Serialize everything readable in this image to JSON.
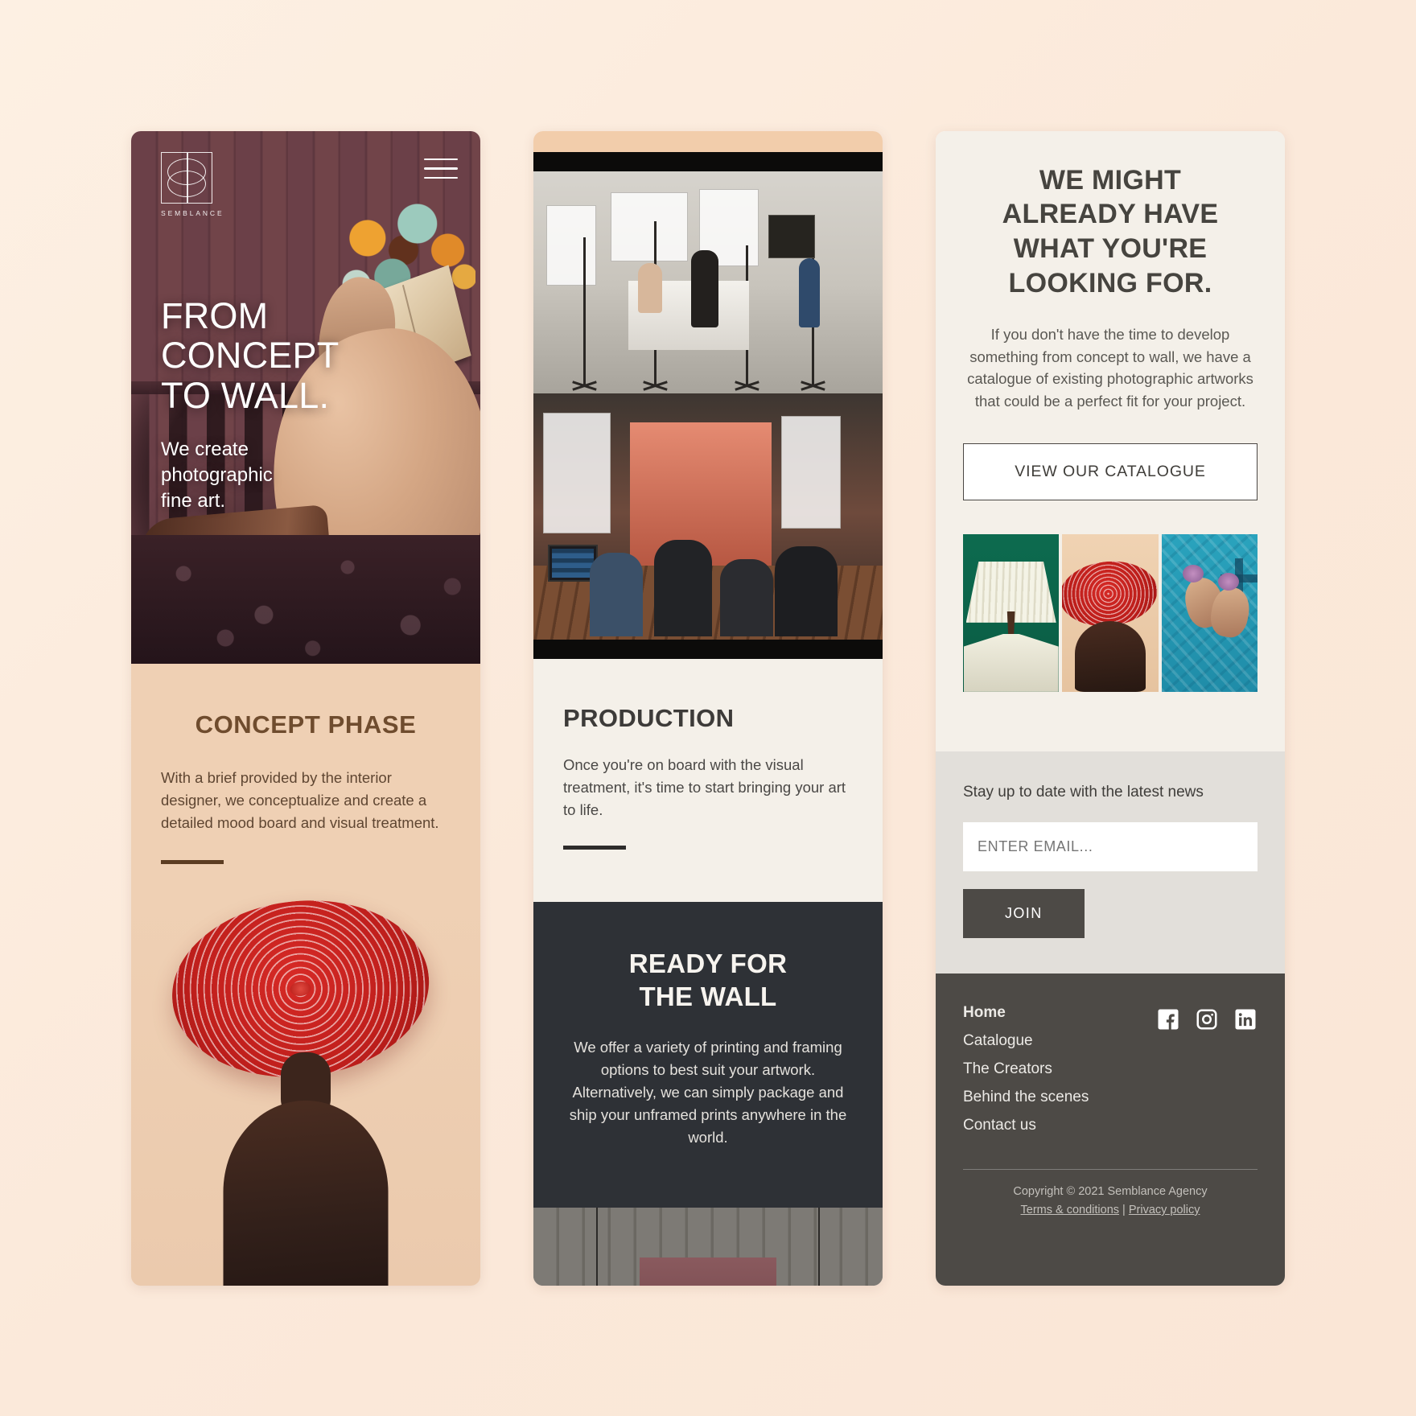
{
  "brand": {
    "name": "SEMBLANCE",
    "logo_icon": "semblance-logo-icon",
    "menu_icon": "hamburger-menu-icon"
  },
  "panel1": {
    "hero": {
      "title_lines": [
        "FROM",
        "CONCEPT",
        "TO WALL."
      ],
      "subtitle_lines": [
        "We create",
        "photographic",
        "fine art."
      ]
    },
    "concept": {
      "heading": "CONCEPT PHASE",
      "body": "With a brief provided by the interior designer,  we conceptualize and create a detailed mood board and visual treatment."
    }
  },
  "panel2": {
    "production": {
      "heading": "PRODUCTION",
      "body": "Once you're on board with the visual treatment, it's time to start bringing your art to life."
    },
    "ready": {
      "heading_lines": [
        "READY FOR",
        "THE WALL"
      ],
      "body": "We offer a variety of printing and framing options to best suit your artwork. Alternatively, we can simply package and ship your unframed prints anywhere in the world."
    }
  },
  "panel3": {
    "catalogue": {
      "heading_lines": [
        "WE MIGHT",
        "ALREADY HAVE",
        "WHAT YOU'RE",
        "LOOKING FOR."
      ],
      "body": "If you don't have the time to develop something from concept to wall, we have a catalogue of existing photographic artworks that could be a perfect fit for your project.",
      "cta_label": "VIEW OUR CATALOGUE",
      "thumbnails": [
        {
          "name": "artwork-white-fan-headpiece",
          "accent": "#0d6b4f"
        },
        {
          "name": "artwork-red-spiral-hat",
          "accent": "#d52a26"
        },
        {
          "name": "artwork-swimmers-blue-water",
          "accent": "#2aa3bd"
        }
      ]
    },
    "newsletter": {
      "lead": "Stay up to date with the latest news",
      "email_placeholder": "ENTER EMAIL...",
      "email_value": "",
      "join_label": "JOIN"
    },
    "footer": {
      "links": [
        {
          "label": "Home",
          "active": true
        },
        {
          "label": "Catalogue",
          "active": false
        },
        {
          "label": "The Creators",
          "active": false
        },
        {
          "label": "Behind the scenes",
          "active": false
        },
        {
          "label": "Contact us",
          "active": false
        }
      ],
      "socials": [
        "facebook-icon",
        "instagram-icon",
        "linkedin-icon"
      ],
      "copyright": "Copyright © 2021 Semblance Agency",
      "terms_label": "Terms & conditions",
      "legal_separator": " | ",
      "privacy_label": "Privacy policy"
    }
  }
}
